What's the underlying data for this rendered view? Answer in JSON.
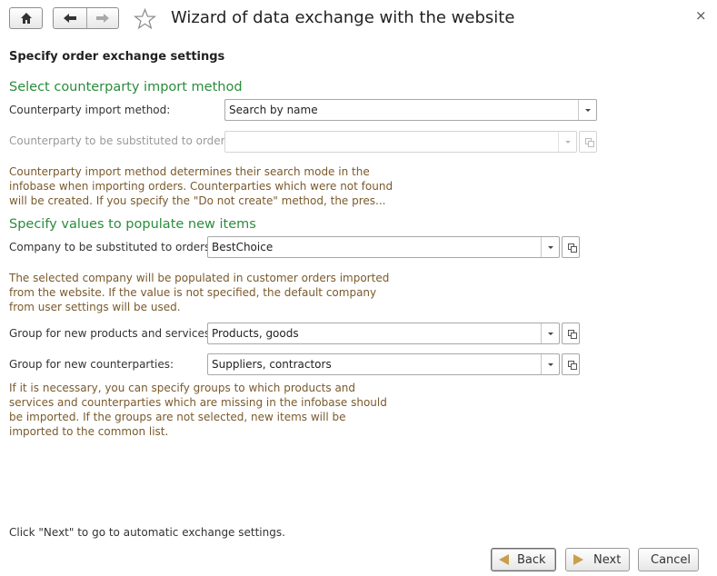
{
  "window": {
    "title": "Wizard of data exchange with the website",
    "close_glyph": "×"
  },
  "toolbar": {
    "icons": [
      "home-icon",
      "back-arrow-icon",
      "forward-arrow-icon",
      "star-icon"
    ]
  },
  "page": {
    "heading": "Specify order exchange settings"
  },
  "import_section": {
    "title": "Select counterparty import method",
    "method_label": "Counterparty import method:",
    "method_value": "Search by name",
    "substitute_label": "Counterparty to be substituted to orders:",
    "substitute_value": "",
    "note_lines": [
      "Counterparty import method determines their search mode in the",
      "infobase when importing orders. Counterparties which were not found",
      "will be created. If you specify the \"Do not create\" method, the pres..."
    ]
  },
  "populate_section": {
    "title": "Specify values to populate new items",
    "company_label": "Company to be substituted to orders:",
    "company_value": "BestChoice",
    "company_note_lines": [
      "The selected company will be populated in customer orders imported",
      "from the website. If the value is not specified, the default company",
      "from user settings will be used."
    ],
    "products_group_label": "Group for new products and services:",
    "products_group_value": "Products, goods",
    "counterparties_group_label": "Group for new counterparties:",
    "counterparties_group_value": "Suppliers, contractors",
    "groups_note_lines": [
      "If it is necessary, you can specify groups to which products and",
      "services and counterparties which are missing in the infobase should",
      "be imported. If the groups are not selected, new items will be",
      "imported to the common list."
    ]
  },
  "footer": {
    "hint": "Click \"Next\" to go to automatic exchange settings.",
    "back_label": "Back",
    "next_label": "Next",
    "cancel_label": "Cancel"
  },
  "colors": {
    "section_title": "#2a8c3c",
    "note_text": "#7a5a2c",
    "nav_arrow": "#c8a04a"
  }
}
